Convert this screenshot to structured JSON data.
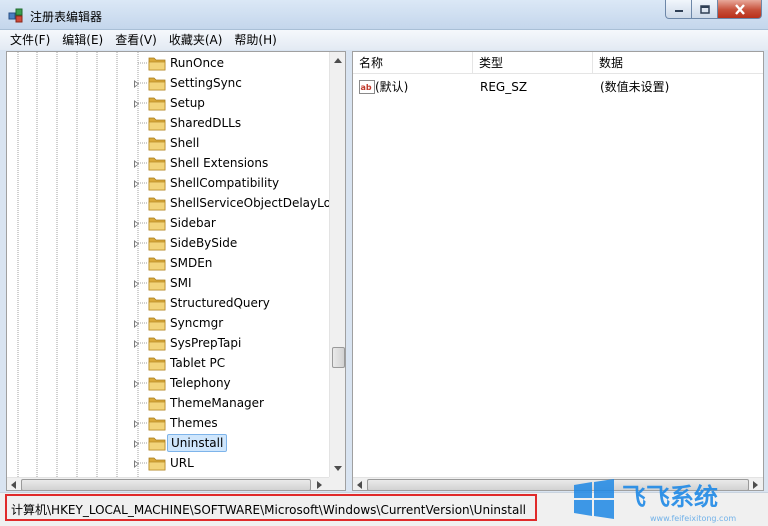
{
  "window": {
    "title": "注册表编辑器",
    "icon": "registry-editor-icon"
  },
  "menu": [
    "文件(F)",
    "编辑(E)",
    "查看(V)",
    "收藏夹(A)",
    "帮助(H)"
  ],
  "tree": {
    "items": [
      {
        "label": "RunOnce",
        "expandable": false
      },
      {
        "label": "SettingSync",
        "expandable": true
      },
      {
        "label": "Setup",
        "expandable": true
      },
      {
        "label": "SharedDLLs",
        "expandable": false
      },
      {
        "label": "Shell",
        "expandable": false
      },
      {
        "label": "Shell Extensions",
        "expandable": true
      },
      {
        "label": "ShellCompatibility",
        "expandable": true
      },
      {
        "label": "ShellServiceObjectDelayLoad",
        "expandable": false
      },
      {
        "label": "Sidebar",
        "expandable": true
      },
      {
        "label": "SideBySide",
        "expandable": true
      },
      {
        "label": "SMDEn",
        "expandable": false
      },
      {
        "label": "SMI",
        "expandable": true
      },
      {
        "label": "StructuredQuery",
        "expandable": false
      },
      {
        "label": "Syncmgr",
        "expandable": true
      },
      {
        "label": "SysPrepTapi",
        "expandable": true
      },
      {
        "label": "Tablet PC",
        "expandable": false
      },
      {
        "label": "Telephony",
        "expandable": true
      },
      {
        "label": "ThemeManager",
        "expandable": false
      },
      {
        "label": "Themes",
        "expandable": true
      },
      {
        "label": "Uninstall",
        "expandable": true,
        "selected": true
      },
      {
        "label": "URL",
        "expandable": true
      }
    ]
  },
  "list": {
    "columns": [
      "名称",
      "类型",
      "数据"
    ],
    "rows": [
      {
        "name": "(默认)",
        "type": "REG_SZ",
        "data": "(数值未设置)",
        "icon": "string-value-icon"
      }
    ]
  },
  "status": {
    "path": "计算机\\HKEY_LOCAL_MACHINE\\SOFTWARE\\Microsoft\\Windows\\CurrentVersion\\Uninstall"
  },
  "watermark": {
    "text": "飞飞系统",
    "url": "www.feifeixitong.com"
  },
  "colors": {
    "selection": "#cfe6fc",
    "highlight_box": "#e02a2a",
    "folder": "#e8c15a"
  }
}
